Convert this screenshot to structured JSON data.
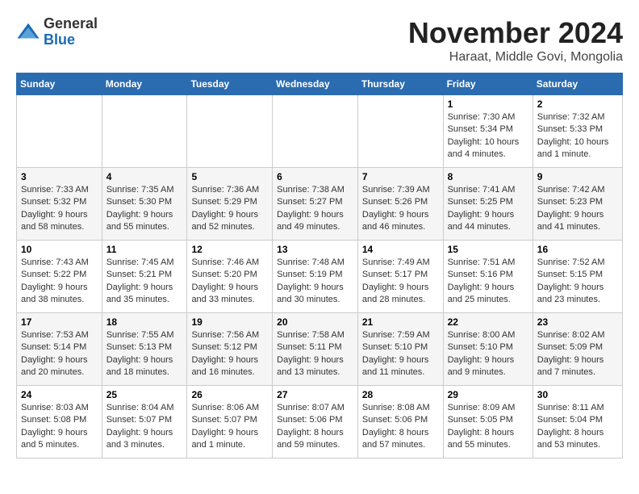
{
  "header": {
    "logo_line1": "General",
    "logo_line2": "Blue",
    "title": "November 2024",
    "subtitle": "Haraat, Middle Govi, Mongolia"
  },
  "weekdays": [
    "Sunday",
    "Monday",
    "Tuesday",
    "Wednesday",
    "Thursday",
    "Friday",
    "Saturday"
  ],
  "weeks": [
    [
      {
        "day": "",
        "info": ""
      },
      {
        "day": "",
        "info": ""
      },
      {
        "day": "",
        "info": ""
      },
      {
        "day": "",
        "info": ""
      },
      {
        "day": "",
        "info": ""
      },
      {
        "day": "1",
        "info": "Sunrise: 7:30 AM\nSunset: 5:34 PM\nDaylight: 10 hours\nand 4 minutes."
      },
      {
        "day": "2",
        "info": "Sunrise: 7:32 AM\nSunset: 5:33 PM\nDaylight: 10 hours\nand 1 minute."
      }
    ],
    [
      {
        "day": "3",
        "info": "Sunrise: 7:33 AM\nSunset: 5:32 PM\nDaylight: 9 hours\nand 58 minutes."
      },
      {
        "day": "4",
        "info": "Sunrise: 7:35 AM\nSunset: 5:30 PM\nDaylight: 9 hours\nand 55 minutes."
      },
      {
        "day": "5",
        "info": "Sunrise: 7:36 AM\nSunset: 5:29 PM\nDaylight: 9 hours\nand 52 minutes."
      },
      {
        "day": "6",
        "info": "Sunrise: 7:38 AM\nSunset: 5:27 PM\nDaylight: 9 hours\nand 49 minutes."
      },
      {
        "day": "7",
        "info": "Sunrise: 7:39 AM\nSunset: 5:26 PM\nDaylight: 9 hours\nand 46 minutes."
      },
      {
        "day": "8",
        "info": "Sunrise: 7:41 AM\nSunset: 5:25 PM\nDaylight: 9 hours\nand 44 minutes."
      },
      {
        "day": "9",
        "info": "Sunrise: 7:42 AM\nSunset: 5:23 PM\nDaylight: 9 hours\nand 41 minutes."
      }
    ],
    [
      {
        "day": "10",
        "info": "Sunrise: 7:43 AM\nSunset: 5:22 PM\nDaylight: 9 hours\nand 38 minutes."
      },
      {
        "day": "11",
        "info": "Sunrise: 7:45 AM\nSunset: 5:21 PM\nDaylight: 9 hours\nand 35 minutes."
      },
      {
        "day": "12",
        "info": "Sunrise: 7:46 AM\nSunset: 5:20 PM\nDaylight: 9 hours\nand 33 minutes."
      },
      {
        "day": "13",
        "info": "Sunrise: 7:48 AM\nSunset: 5:19 PM\nDaylight: 9 hours\nand 30 minutes."
      },
      {
        "day": "14",
        "info": "Sunrise: 7:49 AM\nSunset: 5:17 PM\nDaylight: 9 hours\nand 28 minutes."
      },
      {
        "day": "15",
        "info": "Sunrise: 7:51 AM\nSunset: 5:16 PM\nDaylight: 9 hours\nand 25 minutes."
      },
      {
        "day": "16",
        "info": "Sunrise: 7:52 AM\nSunset: 5:15 PM\nDaylight: 9 hours\nand 23 minutes."
      }
    ],
    [
      {
        "day": "17",
        "info": "Sunrise: 7:53 AM\nSunset: 5:14 PM\nDaylight: 9 hours\nand 20 minutes."
      },
      {
        "day": "18",
        "info": "Sunrise: 7:55 AM\nSunset: 5:13 PM\nDaylight: 9 hours\nand 18 minutes."
      },
      {
        "day": "19",
        "info": "Sunrise: 7:56 AM\nSunset: 5:12 PM\nDaylight: 9 hours\nand 16 minutes."
      },
      {
        "day": "20",
        "info": "Sunrise: 7:58 AM\nSunset: 5:11 PM\nDaylight: 9 hours\nand 13 minutes."
      },
      {
        "day": "21",
        "info": "Sunrise: 7:59 AM\nSunset: 5:10 PM\nDaylight: 9 hours\nand 11 minutes."
      },
      {
        "day": "22",
        "info": "Sunrise: 8:00 AM\nSunset: 5:10 PM\nDaylight: 9 hours\nand 9 minutes."
      },
      {
        "day": "23",
        "info": "Sunrise: 8:02 AM\nSunset: 5:09 PM\nDaylight: 9 hours\nand 7 minutes."
      }
    ],
    [
      {
        "day": "24",
        "info": "Sunrise: 8:03 AM\nSunset: 5:08 PM\nDaylight: 9 hours\nand 5 minutes."
      },
      {
        "day": "25",
        "info": "Sunrise: 8:04 AM\nSunset: 5:07 PM\nDaylight: 9 hours\nand 3 minutes."
      },
      {
        "day": "26",
        "info": "Sunrise: 8:06 AM\nSunset: 5:07 PM\nDaylight: 9 hours\nand 1 minute."
      },
      {
        "day": "27",
        "info": "Sunrise: 8:07 AM\nSunset: 5:06 PM\nDaylight: 8 hours\nand 59 minutes."
      },
      {
        "day": "28",
        "info": "Sunrise: 8:08 AM\nSunset: 5:06 PM\nDaylight: 8 hours\nand 57 minutes."
      },
      {
        "day": "29",
        "info": "Sunrise: 8:09 AM\nSunset: 5:05 PM\nDaylight: 8 hours\nand 55 minutes."
      },
      {
        "day": "30",
        "info": "Sunrise: 8:11 AM\nSunset: 5:04 PM\nDaylight: 8 hours\nand 53 minutes."
      }
    ]
  ]
}
